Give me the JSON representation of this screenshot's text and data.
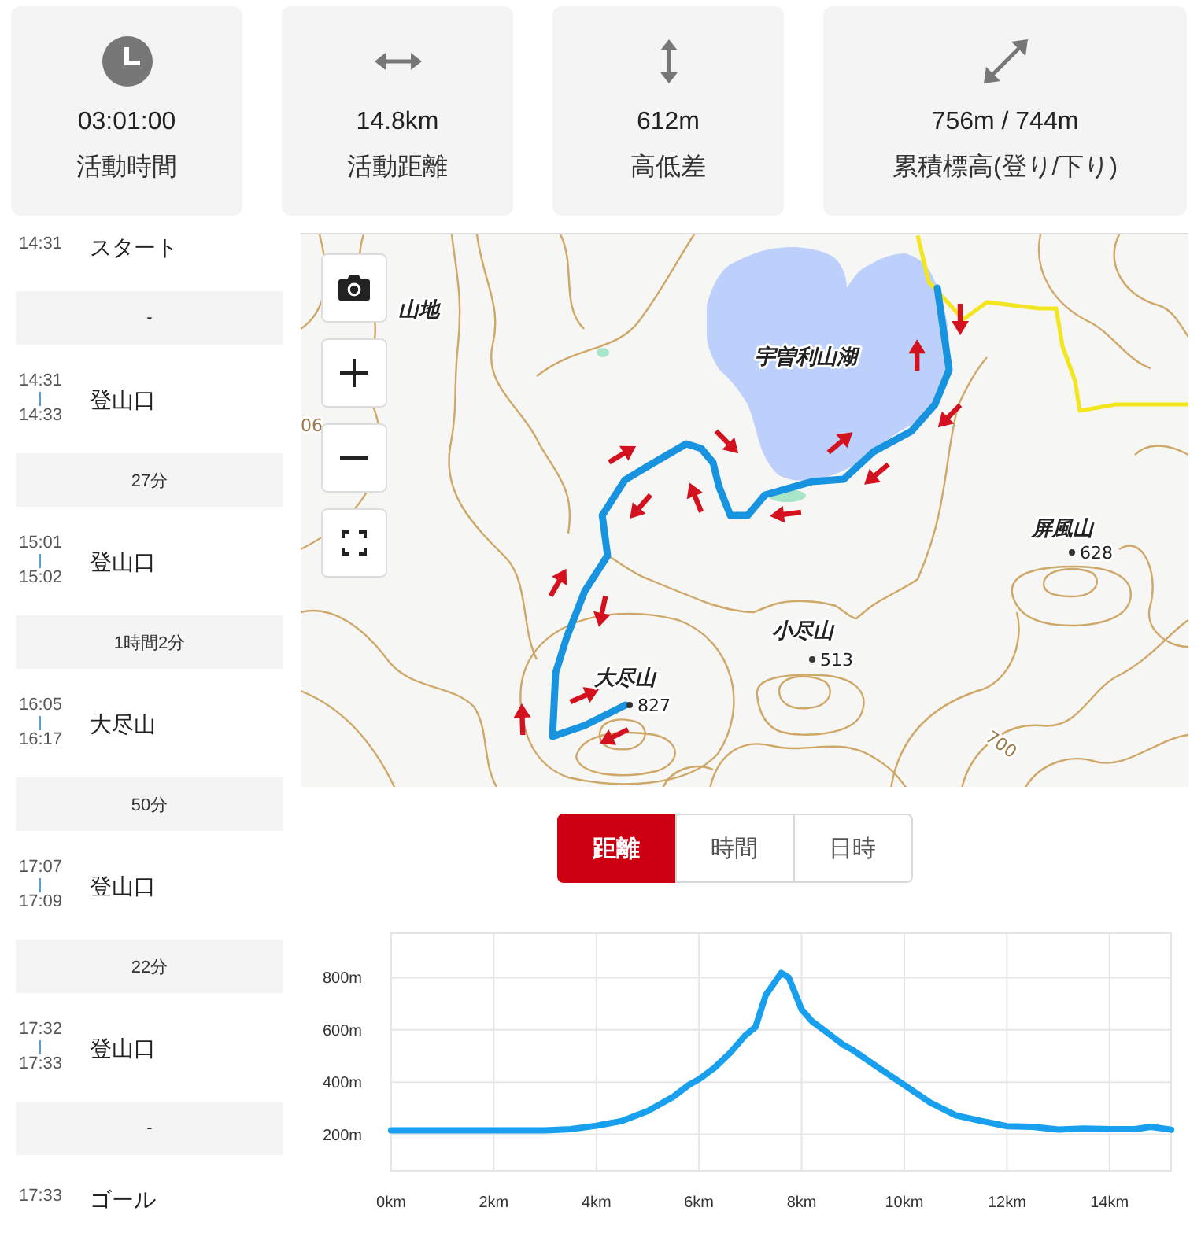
{
  "stats": [
    {
      "kind": "clock",
      "value": "03:01:00",
      "label": "活動時間"
    },
    {
      "kind": "horizontal",
      "value": "14.8km",
      "label": "活動距離"
    },
    {
      "kind": "vertical",
      "value": "612m",
      "label": "高低差"
    },
    {
      "kind": "diagonal",
      "value": "756m / 744m",
      "label": "累積標高(登り/下り)"
    }
  ],
  "timeline": [
    {
      "kind": "point",
      "times": [
        "14:31"
      ],
      "name": "スタート"
    },
    {
      "kind": "gap",
      "text": "-"
    },
    {
      "kind": "point",
      "times": [
        "14:31",
        "14:33"
      ],
      "name": "登山口"
    },
    {
      "kind": "gap",
      "text": "27分"
    },
    {
      "kind": "point",
      "times": [
        "15:01",
        "15:02"
      ],
      "name": "登山口"
    },
    {
      "kind": "gap",
      "text": "1時間2分"
    },
    {
      "kind": "point",
      "times": [
        "16:05",
        "16:17"
      ],
      "name": "大尽山"
    },
    {
      "kind": "gap",
      "text": "50分"
    },
    {
      "kind": "point",
      "times": [
        "17:07",
        "17:09"
      ],
      "name": "登山口"
    },
    {
      "kind": "gap",
      "text": "22分"
    },
    {
      "kind": "point",
      "times": [
        "17:32",
        "17:33"
      ],
      "name": "登山口"
    },
    {
      "kind": "gap",
      "text": "-"
    },
    {
      "kind": "point",
      "times": [
        "17:33"
      ],
      "name": "ゴール"
    }
  ],
  "map": {
    "labels": [
      {
        "kind": "place",
        "text": "山地"
      },
      {
        "kind": "place",
        "text": "宇曽利山湖"
      },
      {
        "kind": "contour",
        "text": "06"
      },
      {
        "kind": "place",
        "text": "屏風山"
      },
      {
        "kind": "elevation",
        "text": "628"
      },
      {
        "kind": "place",
        "text": "小尽山"
      },
      {
        "kind": "elevation",
        "text": "513"
      },
      {
        "kind": "place",
        "text": "大尽山"
      },
      {
        "kind": "elevation",
        "text": "827"
      },
      {
        "kind": "contour",
        "text": "700"
      }
    ]
  },
  "view_tabs": [
    {
      "label": "距離",
      "selected": true
    },
    {
      "label": "時間",
      "selected": false
    },
    {
      "label": "日時",
      "selected": false
    }
  ],
  "elevation": {
    "chart_data": {
      "type": "line",
      "grid": true,
      "x": [
        0,
        2,
        3,
        3.5,
        4,
        4.5,
        5,
        5.5,
        5.8,
        6,
        6.3,
        6.6,
        6.9,
        7.1,
        7.3,
        7.5,
        7.6,
        7.75,
        8,
        8.2,
        8.5,
        8.8,
        9,
        9.5,
        10,
        10.5,
        11,
        11.5,
        12,
        12.5,
        13,
        13.5,
        14,
        14.5,
        14.8,
        15.2
      ],
      "series": [
        {
          "color": "#18a0ee",
          "values": [
            215,
            215,
            215,
            220,
            233,
            251,
            289,
            344,
            389,
            411,
            455,
            511,
            578,
            611,
            733,
            789,
            818,
            800,
            678,
            633,
            589,
            544,
            522,
            455,
            389,
            322,
            273,
            251,
            231,
            229,
            218,
            222,
            220,
            220,
            229,
            218
          ]
        }
      ],
      "xlim": [
        0,
        15.2
      ],
      "ylim": [
        60,
        970
      ],
      "xticks": [
        {
          "value": 0,
          "label": "0km"
        },
        {
          "value": 2,
          "label": "2km"
        },
        {
          "value": 4,
          "label": "4km"
        },
        {
          "value": 6,
          "label": "6km"
        },
        {
          "value": 8,
          "label": "8km"
        },
        {
          "value": 10,
          "label": "10km"
        },
        {
          "value": 12,
          "label": "12km"
        },
        {
          "value": 14,
          "label": "14km"
        }
      ],
      "yticks": [
        {
          "value": 200,
          "label": "200m"
        },
        {
          "value": 400,
          "label": "400m"
        },
        {
          "value": 600,
          "label": "600m"
        },
        {
          "value": 800,
          "label": "800m"
        }
      ]
    }
  }
}
